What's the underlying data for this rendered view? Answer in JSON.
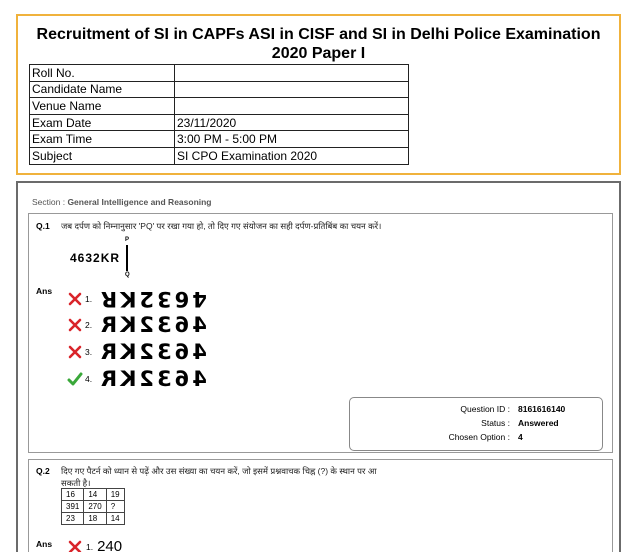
{
  "header": {
    "title_line1": "Recruitment of SI in CAPFs ASI in CISF and SI in Delhi Police Examination",
    "title_line2": "2020 Paper I",
    "rows": [
      {
        "label": "Roll No.",
        "value": ""
      },
      {
        "label": "Candidate Name",
        "value": ""
      },
      {
        "label": "Venue Name",
        "value": ""
      },
      {
        "label": "Exam Date",
        "value": "23/11/2020"
      },
      {
        "label": "Exam Time",
        "value": "3:00 PM - 5:00 PM"
      },
      {
        "label": "Subject",
        "value": "SI CPO Examination 2020"
      }
    ]
  },
  "section": {
    "prefix": "Section : ",
    "name": "General Intelligence and Reasoning"
  },
  "q1": {
    "number": "Q.1",
    "text": "जब दर्पण को निम्नानुसार 'PQ' पर रखा गया हो, तो दिए गए संयोजन का सही दर्पण-प्रतिबिंब का चयन करें।",
    "figure": "4632KR",
    "mirror_top": "P",
    "mirror_bottom": "Q",
    "ans_label": "Ans",
    "options": [
      {
        "num": "1.",
        "text": "4632KR",
        "mark": "wrong"
      },
      {
        "num": "2.",
        "text": "4632KR",
        "mark": "wrong"
      },
      {
        "num": "3.",
        "text": "4632KR",
        "mark": "wrong"
      },
      {
        "num": "4.",
        "text": "4632KR",
        "mark": "correct"
      }
    ],
    "status": {
      "qid_label": "Question ID :",
      "qid_value": "8161616140",
      "status_label": "Status :",
      "status_value": "Answered",
      "chosen_label": "Chosen Option :",
      "chosen_value": "4"
    }
  },
  "q2": {
    "number": "Q.2",
    "text_line1": "दिए गए पैटर्न को ध्यान से पढ़ें और उस संख्या का चयन करें, जो इसमें प्रश्नवाचक चिह्न (?) के स्थान पर आ",
    "text_line2": "सकती है।",
    "grid": [
      [
        "16",
        "14",
        "19"
      ],
      [
        "391",
        "270",
        "?"
      ],
      [
        "23",
        "18",
        "14"
      ]
    ],
    "ans_label": "Ans",
    "option1_num": "1.",
    "option1_text": "240"
  },
  "colors": {
    "header_border": "#f0b23c",
    "wrong": "#d9242a",
    "correct": "#3aa83a"
  }
}
